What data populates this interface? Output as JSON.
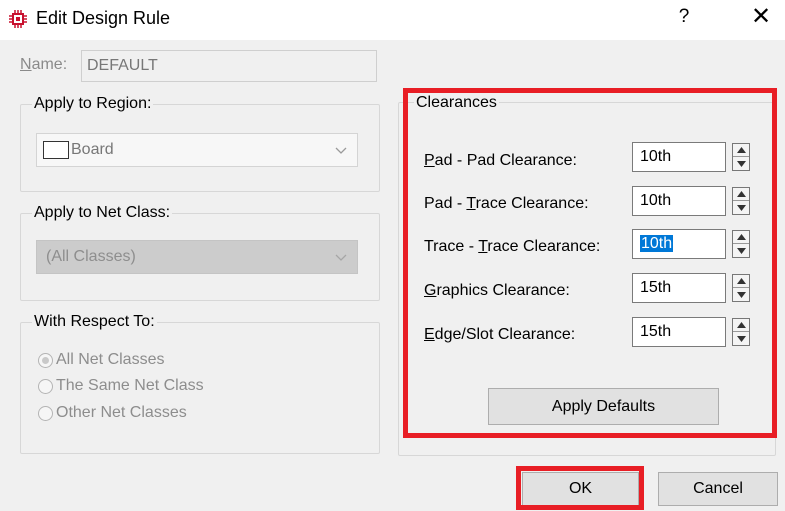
{
  "window": {
    "title": "Edit Design Rule",
    "help_glyph": "?",
    "close_glyph": "✕"
  },
  "name": {
    "label_accel": "N",
    "label_rest": "ame:",
    "value": "DEFAULT"
  },
  "region": {
    "label": "Apply to Region:",
    "value": "Board"
  },
  "net_class": {
    "label": "Apply to Net Class:",
    "value": "(All Classes)"
  },
  "respect": {
    "label": "With Respect To:",
    "options": [
      "All Net Classes",
      "The Same Net Class",
      "Other Net Classes"
    ],
    "selected_index": 0
  },
  "clearances": {
    "label": "Clearances",
    "rows": [
      {
        "label_pre": "",
        "label_accel": "P",
        "label_post": "ad - Pad Clearance:",
        "value": "10th",
        "selected": false
      },
      {
        "label_pre": "Pad - ",
        "label_accel": "T",
        "label_post": "race Clearance:",
        "value": "10th",
        "selected": false
      },
      {
        "label_pre": "Trace - ",
        "label_accel": "T",
        "label_post": "race Clearance:",
        "value": "10th",
        "selected": true
      },
      {
        "label_pre": "",
        "label_accel": "G",
        "label_post": "raphics Clearance:",
        "value": "15th",
        "selected": false
      },
      {
        "label_pre": "",
        "label_accel": "E",
        "label_post": "dge/Slot Clearance:",
        "value": "15th",
        "selected": false
      }
    ],
    "apply_defaults": "Apply Defaults"
  },
  "buttons": {
    "ok": "OK",
    "cancel": "Cancel"
  },
  "colors": {
    "highlight": "#e81e25",
    "selection": "#0078d7",
    "icon": "#c8102e"
  }
}
